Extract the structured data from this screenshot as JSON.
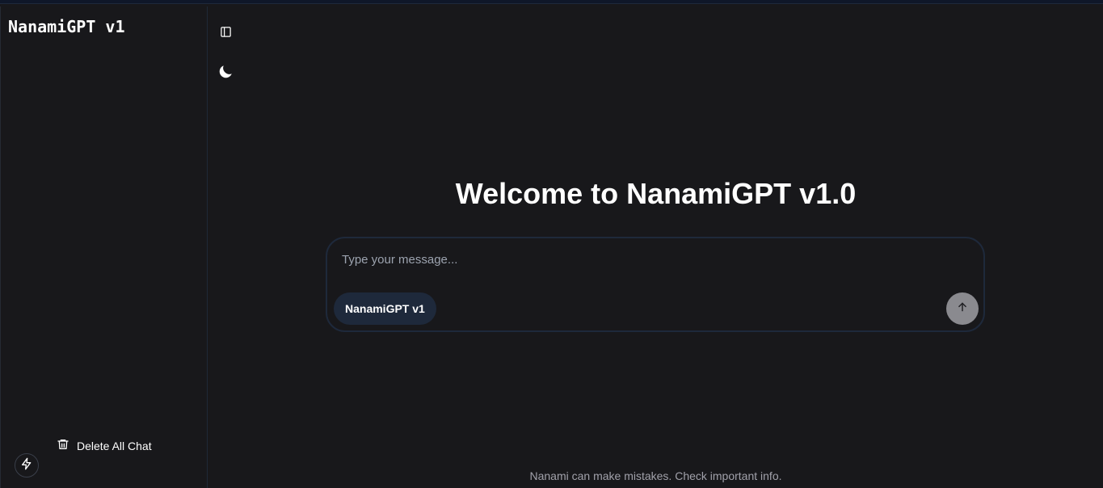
{
  "sidebar": {
    "title": "NanamiGPT v1",
    "delete_all_label": "Delete All Chat",
    "delete_icon": "trash-icon",
    "bottom_icon": "bolt-icon"
  },
  "toolbar": {
    "panel_toggle_icon": "sidebar-panel-icon",
    "theme_toggle_icon": "moon-icon"
  },
  "main": {
    "welcome_title": "Welcome to NanamiGPT v1.0",
    "composer": {
      "placeholder": "Type your message...",
      "value": "",
      "model_label": "NanamiGPT v1",
      "send_icon": "arrow-up-icon"
    },
    "footer_note": "Nanami can make mistakes. Check important info."
  },
  "colors": {
    "background": "#18181b",
    "accent_chip": "#1e293b",
    "send_button": "#8a8a8f",
    "muted_text": "#a1a1aa"
  }
}
